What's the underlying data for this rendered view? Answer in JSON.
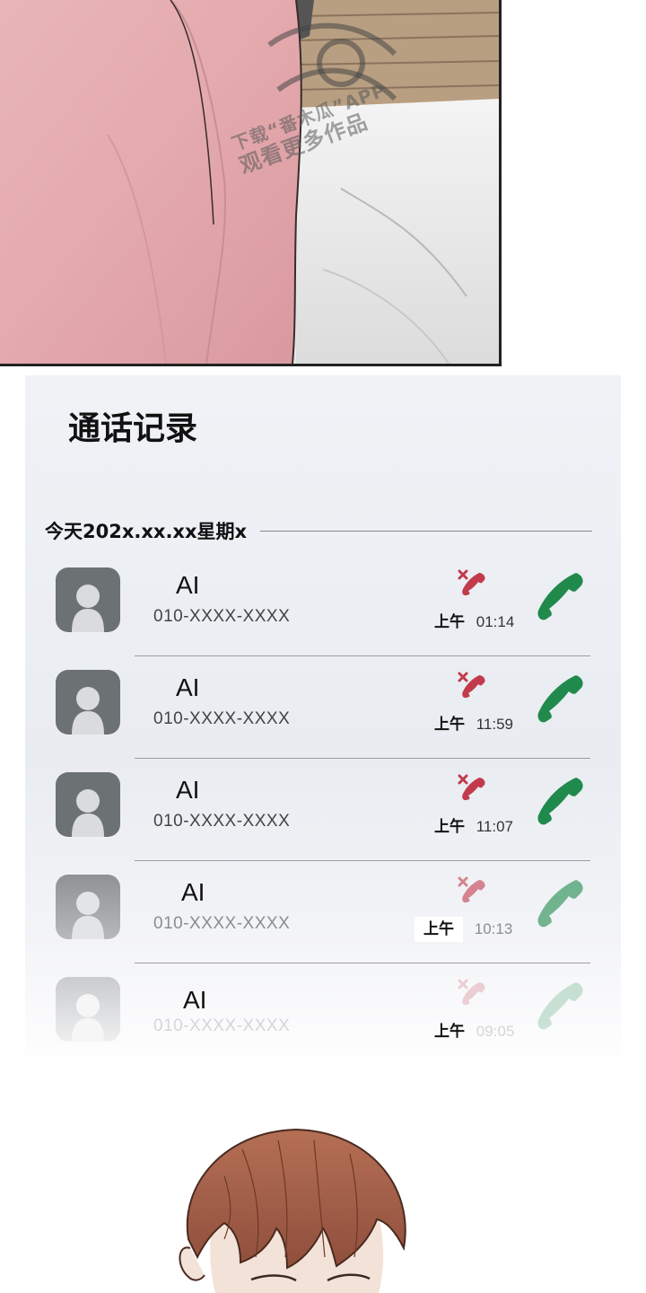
{
  "watermark": {
    "line1": "下载“番木瓜”APP",
    "line2": "观看更多作品"
  },
  "call_log": {
    "title": "通话记录",
    "date_label": "今天202x.xx.xx星期x",
    "entries": [
      {
        "name": "AI",
        "number": "010-XXXX-XXXX",
        "ampm": "上午",
        "time": "01:14"
      },
      {
        "name": "AI",
        "number": "010-XXXX-XXXX",
        "ampm": "上午",
        "time": "11:59"
      },
      {
        "name": "AI",
        "number": "010-XXXX-XXXX",
        "ampm": "上午",
        "time": "11:07"
      },
      {
        "name": "AI",
        "number": "010-XXXX-XXXX",
        "ampm": "上午",
        "time": "10:13"
      },
      {
        "name": "AI",
        "number": "010-XXXX-XXXX",
        "ampm": "上午",
        "time": "09:05"
      }
    ],
    "icons": {
      "avatar": "person-icon",
      "missed": "missed-call-icon",
      "call": "phone-call-icon"
    },
    "colors": {
      "missed": "#c23b4c",
      "call": "#1f8a4c",
      "avatar": "#6c7174"
    }
  }
}
